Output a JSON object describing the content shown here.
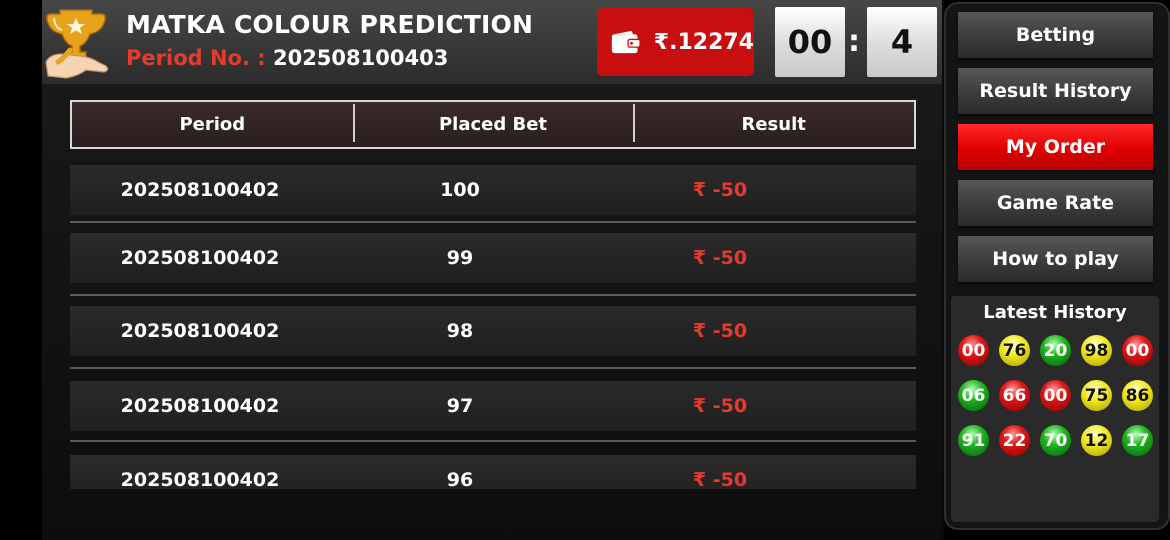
{
  "header": {
    "title": "MATKA COLOUR PREDICTION",
    "period_label": "Period No. :",
    "period_value": "202508100403",
    "wallet_amount": "₹.12274",
    "timer_minutes": "00",
    "timer_colon": ":",
    "timer_seconds": "4"
  },
  "table": {
    "columns": [
      "Period",
      "Placed Bet",
      "Result"
    ],
    "rows": [
      {
        "period": "202508100402",
        "bet": "100",
        "result": "₹ -50"
      },
      {
        "period": "202508100402",
        "bet": "99",
        "result": "₹ -50"
      },
      {
        "period": "202508100402",
        "bet": "98",
        "result": "₹ -50"
      },
      {
        "period": "202508100402",
        "bet": "97",
        "result": "₹ -50"
      },
      {
        "period": "202508100402",
        "bet": "96",
        "result": "₹ -50"
      }
    ]
  },
  "sidebar": {
    "buttons": [
      "Betting",
      "Result History",
      "My Order",
      "Game Rate",
      "How to play"
    ],
    "active": "My Order",
    "history_title": "Latest History",
    "history": [
      {
        "n": "00",
        "c": "red"
      },
      {
        "n": "76",
        "c": "yellow"
      },
      {
        "n": "20",
        "c": "green"
      },
      {
        "n": "98",
        "c": "yellow"
      },
      {
        "n": "00",
        "c": "red"
      },
      {
        "n": "06",
        "c": "green"
      },
      {
        "n": "66",
        "c": "red"
      },
      {
        "n": "00",
        "c": "red"
      },
      {
        "n": "75",
        "c": "yellow"
      },
      {
        "n": "86",
        "c": "yellow"
      },
      {
        "n": "91",
        "c": "green"
      },
      {
        "n": "22",
        "c": "red"
      },
      {
        "n": "70",
        "c": "green"
      },
      {
        "n": "12",
        "c": "yellow"
      },
      {
        "n": "17",
        "c": "green"
      }
    ]
  },
  "colors": {
    "accent_red": "#e53a2e",
    "active_button": "#e00000",
    "wallet_bg": "#c70f0f"
  },
  "icons": {
    "logo": "trophy-hand-icon",
    "wallet": "wallet-icon"
  }
}
